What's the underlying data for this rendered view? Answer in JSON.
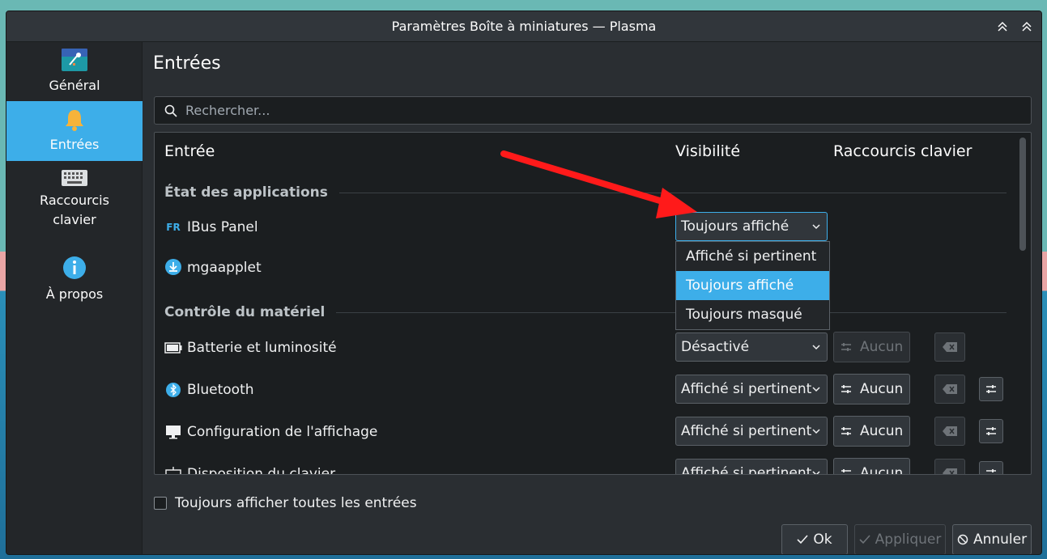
{
  "window": {
    "title": "Paramètres Boîte à miniatures — Plasma"
  },
  "sidebar": {
    "items": [
      {
        "label": "Général",
        "icon": "general-settings-icon"
      },
      {
        "label": "Entrées",
        "icon": "bell-icon",
        "active": true
      },
      {
        "label": "Raccourcis\nclavier",
        "icon": "keyboard-icon"
      },
      {
        "label": "À propos",
        "icon": "info-icon"
      }
    ]
  },
  "main": {
    "heading": "Entrées",
    "search_placeholder": "Rechercher...",
    "columns": {
      "entry": "Entrée",
      "visibility": "Visibilité",
      "shortcuts": "Raccourcis clavier"
    },
    "sections": [
      {
        "title": "État des applications"
      },
      {
        "title": "Contrôle du matériel"
      }
    ],
    "rows": [
      {
        "label": "IBus Panel",
        "icon_text": "FR",
        "visibility": "Toujours affiché"
      },
      {
        "label": "mgaapplet"
      },
      {
        "label": "Batterie et luminosité",
        "visibility": "Désactivé",
        "shortcut": "Aucun"
      },
      {
        "label": "Bluetooth",
        "visibility": "Affiché si pertinent",
        "shortcut": "Aucun"
      },
      {
        "label": "Configuration de l'affichage",
        "visibility": "Affiché si pertinent",
        "shortcut": "Aucun"
      },
      {
        "label": "Disposition du clavier",
        "visibility": "Affiché si pertinent",
        "shortcut": "Aucun"
      }
    ],
    "dropdown_options": [
      "Affiché si pertinent",
      "Toujours affiché",
      "Toujours masqué"
    ],
    "dropdown_selected_index": 1,
    "show_all_label": "Toujours afficher toutes les entrées"
  },
  "footer": {
    "ok": "Ok",
    "apply": "Appliquer",
    "cancel": "Annuler"
  },
  "colors": {
    "accent": "#3daee9",
    "arrow": "#ff1a1a"
  }
}
